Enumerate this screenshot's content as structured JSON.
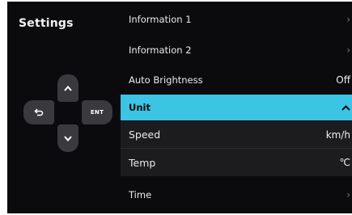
{
  "sidebar": {
    "title": "Settings"
  },
  "dpad": {
    "up_icon": "chevron-up-icon",
    "down_icon": "chevron-down-icon",
    "back_icon": "return-arrow-icon",
    "ent_label": "ENT"
  },
  "menu": {
    "items": [
      {
        "label": "Information 1",
        "value": "",
        "icon": "chevron-right-icon"
      },
      {
        "label": "Information 2",
        "value": "",
        "icon": "chevron-right-icon"
      },
      {
        "label": "Auto Brightness",
        "value": "Off",
        "icon": ""
      },
      {
        "label": "Unit",
        "value": "",
        "icon": "chevron-up-icon",
        "selected": true
      },
      {
        "label": "Speed",
        "value": "km/h",
        "icon": ""
      },
      {
        "label": "Temp",
        "value": "℃",
        "icon": ""
      },
      {
        "label": "Time",
        "value": "",
        "icon": "chevron-right-icon"
      }
    ]
  },
  "colors": {
    "panel_background": "#0b0b0d",
    "selected_row": "#3bc4e3",
    "submenu_row": "#1c1c1f",
    "dpad_button": "#3a3a3e"
  }
}
